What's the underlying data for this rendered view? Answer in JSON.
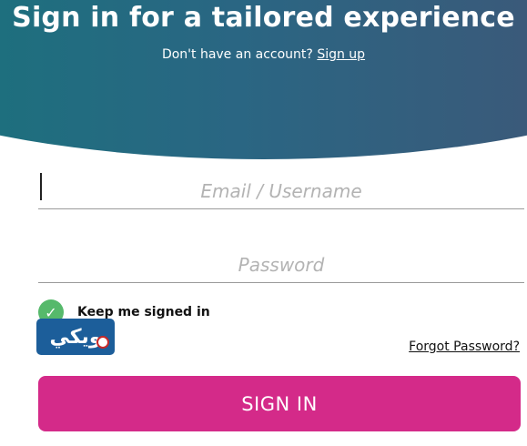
{
  "hero": {
    "title": "Sign in for a tailored experience",
    "subtitle_prefix": "Don't have an account?",
    "signup_link": "Sign up"
  },
  "form": {
    "email_placeholder": "Email / Username",
    "password_placeholder": "Password",
    "keep_signed_in_label": "Keep me signed in",
    "keep_signed_in_checked": true,
    "forgot_password_label": "Forgot Password?",
    "submit_label": "SIGN IN"
  },
  "overlay_logo": {
    "text": "ويكي"
  },
  "colors": {
    "hero_gradient_start": "#1e6f7e",
    "hero_gradient_end": "#3a5a7a",
    "check_green": "#56b96b",
    "submit_pink": "#d42a89",
    "logo_blue": "#1c5e9a"
  }
}
